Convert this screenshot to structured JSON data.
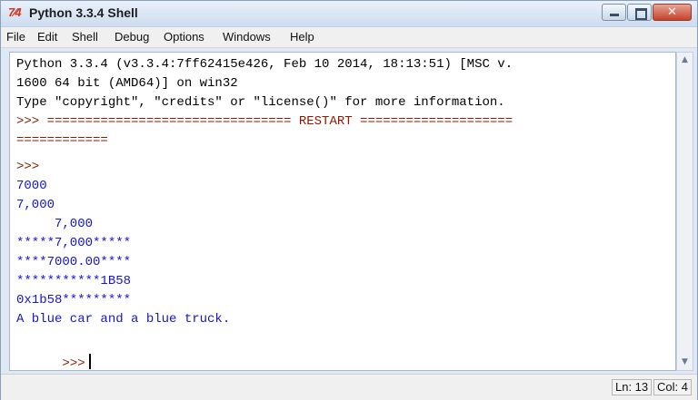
{
  "window": {
    "title": "Python 3.3.4 Shell",
    "icon": "idle-icon",
    "icon_text": "7⁄4",
    "close_glyph": "✕"
  },
  "menu": [
    "File",
    "Edit",
    "Shell",
    "Debug",
    "Options",
    "Windows",
    "Help"
  ],
  "shell": {
    "lines": [
      {
        "style": "black",
        "text": "Python 3.3.4 (v3.3.4:7ff62415e426, Feb 10 2014, 18:13:51) [MSC v."
      },
      {
        "style": "black",
        "text": "1600 64 bit (AMD64)] on win32"
      },
      {
        "style": "black",
        "text": "Type \"copyright\", \"credits\" or \"license()\" for more information."
      },
      {
        "style": "prompt",
        "text": ">>> ================================ RESTART ===================="
      },
      {
        "style": "prompt",
        "text": "============"
      },
      {
        "style": "prompt",
        "text": ">>>"
      },
      {
        "style": "blue",
        "text": "7000"
      },
      {
        "style": "blue",
        "text": "7,000"
      },
      {
        "style": "blue",
        "text": "     7,000"
      },
      {
        "style": "blue",
        "text": "*****7,000*****"
      },
      {
        "style": "blue",
        "text": "****7000.00****"
      },
      {
        "style": "blue",
        "text": "***********1B58"
      },
      {
        "style": "blue",
        "text": "0x1b58*********"
      },
      {
        "style": "blue",
        "text": "A blue car and a blue truck."
      }
    ],
    "final_prompt": ">>>"
  },
  "status": {
    "line": "Ln: 13",
    "col": "Col: 4"
  },
  "colors": {
    "output_blue": "#1515cc",
    "prompt_red": "#8b1a00",
    "text_black": "#000000"
  }
}
